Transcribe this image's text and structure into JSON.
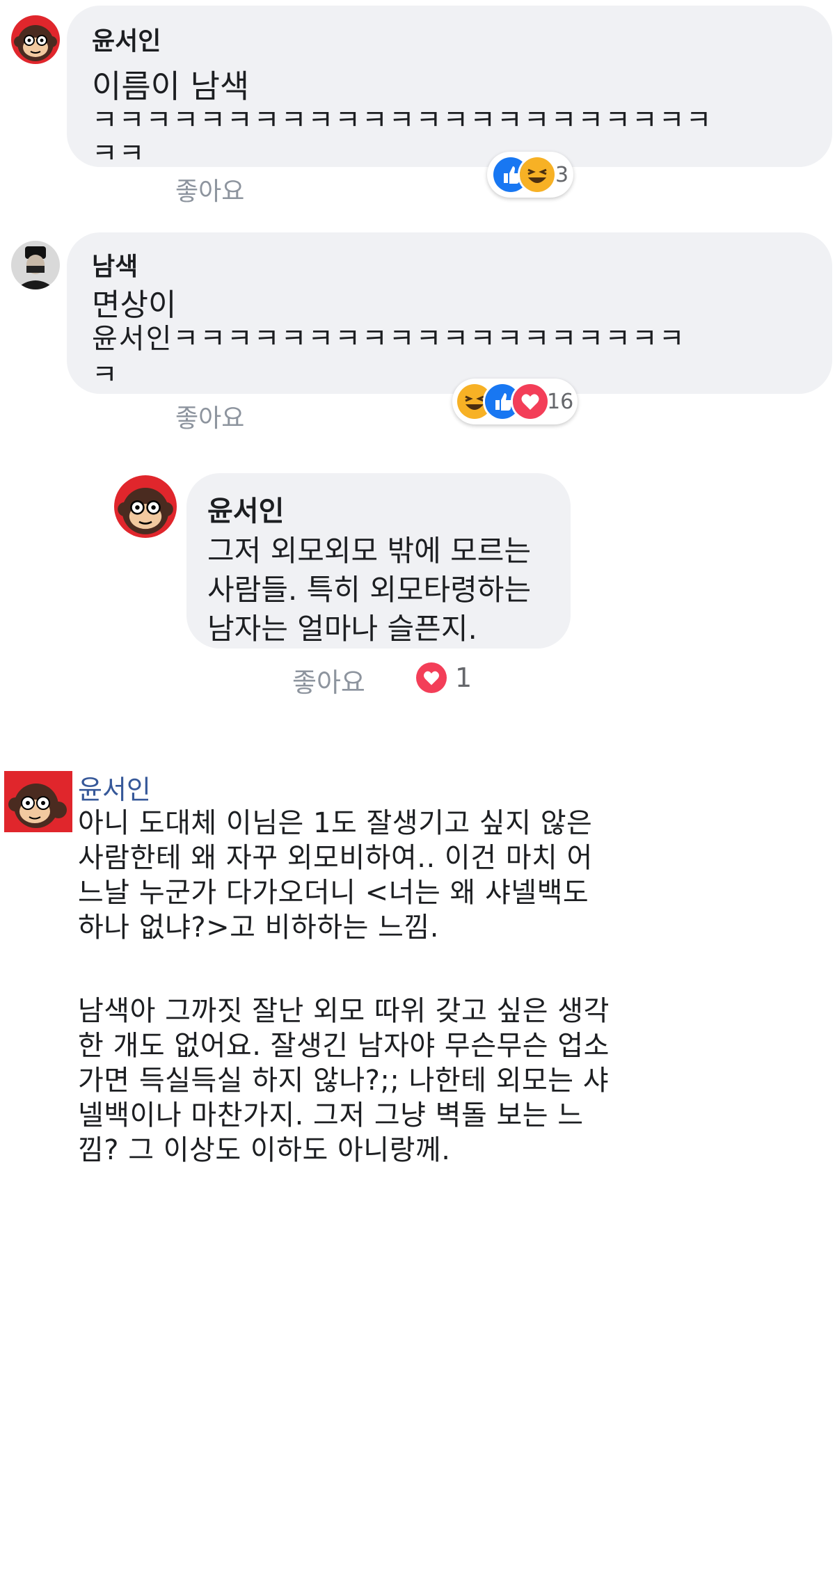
{
  "comments": [
    {
      "author": "윤서인",
      "lines": [
        "이름이 남색",
        "ㅋㅋㅋㅋㅋㅋㅋㅋㅋㅋㅋㅋㅋㅋㅋㅋㅋㅋㅋㅋㅋㅋㅋ",
        "ㅋㅋ"
      ],
      "like_label": "좋아요",
      "reactions": [
        "like",
        "haha"
      ],
      "reaction_count": "3"
    },
    {
      "author": "남색",
      "lines": [
        "면상이",
        "윤서인ㅋㅋㅋㅋㅋㅋㅋㅋㅋㅋㅋㅋㅋㅋㅋㅋㅋㅋㅋ",
        "ㅋ"
      ],
      "like_label": "좋아요",
      "reactions": [
        "haha",
        "like",
        "love"
      ],
      "reaction_count": "16"
    },
    {
      "author": "윤서인",
      "lines": [
        "그저 외모외모 밖에 모르는",
        "사람들. 특히 외모타령하는",
        "남자는 얼마나 슬픈지."
      ],
      "like_label": "좋아요",
      "reactions": [
        "love"
      ],
      "reaction_count": "1"
    }
  ],
  "post": {
    "author": "윤서인",
    "lines": [
      "아니 도대체 이님은 1도 잘생기고 싶지 않은",
      "사람한테 왜 자꾸 외모비하여.. 이건 마치 어",
      "느날 누군가 다가오더니 <너는 왜 샤넬백도",
      "하나 없냐?>고 비하하는 느낌.",
      "",
      "남색아 그까짓 잘난 외모 따위 갖고 싶은 생각",
      "한 개도 없어요. 잘생긴 남자야 무슨무슨 업소",
      "가면 득실득실 하지 않나?;; 나한테 외모는 샤",
      "넬백이나 마찬가지. 그저 그냥 벽돌 보는 느",
      "낌? 그 이상도 이하도 아니랑께."
    ]
  },
  "colors": {
    "bubble_bg": "#f0f1f4",
    "link_blue": "#365899",
    "like_blue": "#1877f2",
    "love_red": "#f33e58",
    "haha_yellow": "#f7b125",
    "meta_gray": "#8d949e"
  },
  "icons": {
    "like": "thumbs-up-icon",
    "haha": "laughing-face-icon",
    "love": "heart-icon"
  }
}
